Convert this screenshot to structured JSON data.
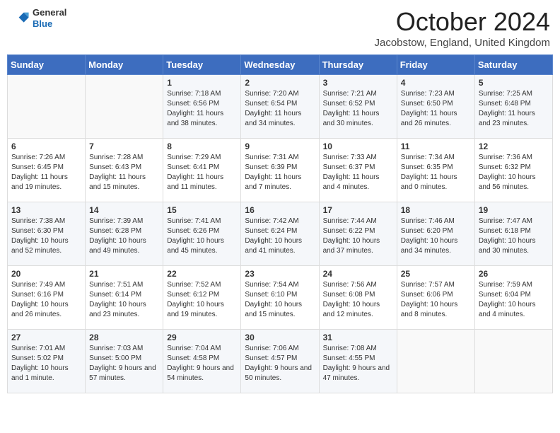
{
  "header": {
    "logo_general": "General",
    "logo_blue": "Blue",
    "month_title": "October 2024",
    "location": "Jacobstow, England, United Kingdom"
  },
  "days_of_week": [
    "Sunday",
    "Monday",
    "Tuesday",
    "Wednesday",
    "Thursday",
    "Friday",
    "Saturday"
  ],
  "weeks": [
    [
      {
        "day": "",
        "info": ""
      },
      {
        "day": "",
        "info": ""
      },
      {
        "day": "1",
        "info": "Sunrise: 7:18 AM\nSunset: 6:56 PM\nDaylight: 11 hours and 38 minutes."
      },
      {
        "day": "2",
        "info": "Sunrise: 7:20 AM\nSunset: 6:54 PM\nDaylight: 11 hours and 34 minutes."
      },
      {
        "day": "3",
        "info": "Sunrise: 7:21 AM\nSunset: 6:52 PM\nDaylight: 11 hours and 30 minutes."
      },
      {
        "day": "4",
        "info": "Sunrise: 7:23 AM\nSunset: 6:50 PM\nDaylight: 11 hours and 26 minutes."
      },
      {
        "day": "5",
        "info": "Sunrise: 7:25 AM\nSunset: 6:48 PM\nDaylight: 11 hours and 23 minutes."
      }
    ],
    [
      {
        "day": "6",
        "info": "Sunrise: 7:26 AM\nSunset: 6:45 PM\nDaylight: 11 hours and 19 minutes."
      },
      {
        "day": "7",
        "info": "Sunrise: 7:28 AM\nSunset: 6:43 PM\nDaylight: 11 hours and 15 minutes."
      },
      {
        "day": "8",
        "info": "Sunrise: 7:29 AM\nSunset: 6:41 PM\nDaylight: 11 hours and 11 minutes."
      },
      {
        "day": "9",
        "info": "Sunrise: 7:31 AM\nSunset: 6:39 PM\nDaylight: 11 hours and 7 minutes."
      },
      {
        "day": "10",
        "info": "Sunrise: 7:33 AM\nSunset: 6:37 PM\nDaylight: 11 hours and 4 minutes."
      },
      {
        "day": "11",
        "info": "Sunrise: 7:34 AM\nSunset: 6:35 PM\nDaylight: 11 hours and 0 minutes."
      },
      {
        "day": "12",
        "info": "Sunrise: 7:36 AM\nSunset: 6:32 PM\nDaylight: 10 hours and 56 minutes."
      }
    ],
    [
      {
        "day": "13",
        "info": "Sunrise: 7:38 AM\nSunset: 6:30 PM\nDaylight: 10 hours and 52 minutes."
      },
      {
        "day": "14",
        "info": "Sunrise: 7:39 AM\nSunset: 6:28 PM\nDaylight: 10 hours and 49 minutes."
      },
      {
        "day": "15",
        "info": "Sunrise: 7:41 AM\nSunset: 6:26 PM\nDaylight: 10 hours and 45 minutes."
      },
      {
        "day": "16",
        "info": "Sunrise: 7:42 AM\nSunset: 6:24 PM\nDaylight: 10 hours and 41 minutes."
      },
      {
        "day": "17",
        "info": "Sunrise: 7:44 AM\nSunset: 6:22 PM\nDaylight: 10 hours and 37 minutes."
      },
      {
        "day": "18",
        "info": "Sunrise: 7:46 AM\nSunset: 6:20 PM\nDaylight: 10 hours and 34 minutes."
      },
      {
        "day": "19",
        "info": "Sunrise: 7:47 AM\nSunset: 6:18 PM\nDaylight: 10 hours and 30 minutes."
      }
    ],
    [
      {
        "day": "20",
        "info": "Sunrise: 7:49 AM\nSunset: 6:16 PM\nDaylight: 10 hours and 26 minutes."
      },
      {
        "day": "21",
        "info": "Sunrise: 7:51 AM\nSunset: 6:14 PM\nDaylight: 10 hours and 23 minutes."
      },
      {
        "day": "22",
        "info": "Sunrise: 7:52 AM\nSunset: 6:12 PM\nDaylight: 10 hours and 19 minutes."
      },
      {
        "day": "23",
        "info": "Sunrise: 7:54 AM\nSunset: 6:10 PM\nDaylight: 10 hours and 15 minutes."
      },
      {
        "day": "24",
        "info": "Sunrise: 7:56 AM\nSunset: 6:08 PM\nDaylight: 10 hours and 12 minutes."
      },
      {
        "day": "25",
        "info": "Sunrise: 7:57 AM\nSunset: 6:06 PM\nDaylight: 10 hours and 8 minutes."
      },
      {
        "day": "26",
        "info": "Sunrise: 7:59 AM\nSunset: 6:04 PM\nDaylight: 10 hours and 4 minutes."
      }
    ],
    [
      {
        "day": "27",
        "info": "Sunrise: 7:01 AM\nSunset: 5:02 PM\nDaylight: 10 hours and 1 minute."
      },
      {
        "day": "28",
        "info": "Sunrise: 7:03 AM\nSunset: 5:00 PM\nDaylight: 9 hours and 57 minutes."
      },
      {
        "day": "29",
        "info": "Sunrise: 7:04 AM\nSunset: 4:58 PM\nDaylight: 9 hours and 54 minutes."
      },
      {
        "day": "30",
        "info": "Sunrise: 7:06 AM\nSunset: 4:57 PM\nDaylight: 9 hours and 50 minutes."
      },
      {
        "day": "31",
        "info": "Sunrise: 7:08 AM\nSunset: 4:55 PM\nDaylight: 9 hours and 47 minutes."
      },
      {
        "day": "",
        "info": ""
      },
      {
        "day": "",
        "info": ""
      }
    ]
  ]
}
